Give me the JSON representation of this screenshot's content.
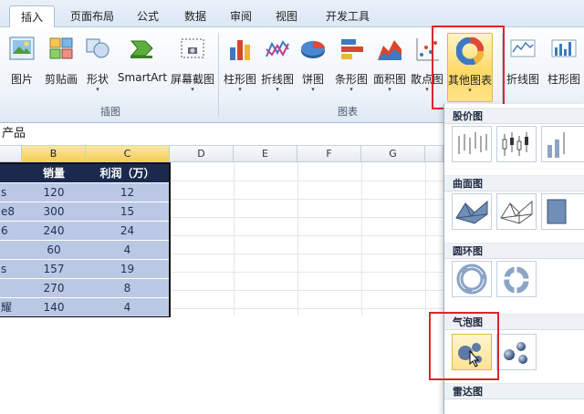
{
  "tabs": [
    {
      "label": "插入",
      "active": true
    },
    {
      "label": "页面布局",
      "active": false
    },
    {
      "label": "公式",
      "active": false
    },
    {
      "label": "数据",
      "active": false
    },
    {
      "label": "审阅",
      "active": false
    },
    {
      "label": "视图",
      "active": false
    },
    {
      "label": "开发工具",
      "active": false
    }
  ],
  "ribbon": {
    "illustrations": {
      "group_label": "插图",
      "buttons": [
        {
          "label": "图片",
          "icon": "picture-icon"
        },
        {
          "label": "剪贴画",
          "icon": "clipart-icon"
        },
        {
          "label": "形状",
          "icon": "shapes-icon",
          "dropdown": "▾"
        },
        {
          "label": "SmartArt",
          "icon": "smartart-icon"
        },
        {
          "label": "屏幕截图",
          "icon": "screenshot-icon",
          "dropdown": "▾"
        }
      ]
    },
    "charts": {
      "group_label": "图表",
      "buttons": [
        {
          "label": "柱形图",
          "icon": "column-chart-icon",
          "dropdown": "▾"
        },
        {
          "label": "折线图",
          "icon": "line-chart-icon",
          "dropdown": "▾"
        },
        {
          "label": "饼图",
          "icon": "pie-chart-icon",
          "dropdown": "▾"
        },
        {
          "label": "条形图",
          "icon": "bar-chart-icon",
          "dropdown": "▾"
        },
        {
          "label": "面积图",
          "icon": "area-chart-icon",
          "dropdown": "▾"
        },
        {
          "label": "散点图",
          "icon": "scatter-chart-icon",
          "dropdown": "▾"
        },
        {
          "label": "其他图表",
          "icon": "other-charts-icon",
          "dropdown": "▾",
          "active": true
        }
      ]
    },
    "sparklines": {
      "buttons": [
        {
          "label": "折线图",
          "icon": "sparkline-line-icon"
        },
        {
          "label": "柱形图",
          "icon": "sparkline-column-icon"
        }
      ]
    }
  },
  "formula_bar": {
    "value": "产品"
  },
  "grid": {
    "columns": [
      "B",
      "C",
      "D",
      "E",
      "F",
      "G"
    ],
    "selected_columns": [
      "B",
      "C"
    ],
    "table": {
      "headers": [
        "销量",
        "利润（万）"
      ],
      "rows": [
        {
          "a": "s",
          "b": "120",
          "c": "12"
        },
        {
          "a": "e8",
          "b": "300",
          "c": "15"
        },
        {
          "a": "6",
          "b": "240",
          "c": "24"
        },
        {
          "a": "",
          "b": "60",
          "c": "4"
        },
        {
          "a": "s",
          "b": "157",
          "c": "19"
        },
        {
          "a": "",
          "b": "270",
          "c": "8"
        },
        {
          "a": "耀",
          "b": "140",
          "c": "4"
        }
      ]
    }
  },
  "gallery": {
    "sections": [
      {
        "title": "股价图"
      },
      {
        "title": "曲面图"
      },
      {
        "title": "圆环图"
      },
      {
        "title": "气泡图"
      },
      {
        "title": "雷达图"
      }
    ]
  },
  "colors": {
    "accent_red": "#d9262c",
    "highlight_gold": "#ffd969",
    "table_header": "#1a2a4f",
    "table_body": "#bac8e4"
  }
}
